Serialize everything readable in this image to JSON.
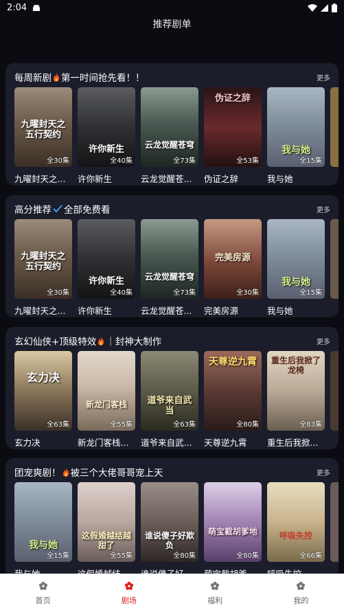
{
  "status": {
    "time": "2:04"
  },
  "header": {
    "title": "推荐剧单"
  },
  "sections": [
    {
      "title_a": "每周新剧",
      "title_b": "第一时间抢先看！！",
      "more": "更多",
      "items": [
        {
          "name": "九曜封天之...",
          "ep": "全30集",
          "poster_text": "九曜封天之五行契约",
          "color": "#6b5b4a"
        },
        {
          "name": "许你新生",
          "ep": "全40集",
          "poster_text": "许你新生",
          "color": "#2f3033"
        },
        {
          "name": "云龙觉醒苍...",
          "ep": "全73集",
          "poster_text": "云龙觉醒苍穹",
          "color": "#4a5a52"
        },
        {
          "name": "伪证之辞",
          "ep": "全53集",
          "poster_text": "伪证之辞",
          "color": "#4a1f22"
        },
        {
          "name": "我与她",
          "ep": "全15集",
          "poster_text": "我与她",
          "color": "#7d8a98"
        }
      ]
    },
    {
      "title_a": "高分推荐",
      "title_b": "全部免费看",
      "more": "更多",
      "items": [
        {
          "name": "九曜封天之...",
          "ep": "全30集",
          "poster_text": "九曜封天之五行契约",
          "color": "#6b5b4a"
        },
        {
          "name": "许你新生",
          "ep": "全40集",
          "poster_text": "许你新生",
          "color": "#2f3033"
        },
        {
          "name": "云龙觉醒苍...",
          "ep": "全73集",
          "poster_text": "云龙觉醒苍穹",
          "color": "#4a5a52"
        },
        {
          "name": "完美房源",
          "ep": "全30集",
          "poster_text": "完美房源",
          "color": "#7a4638"
        },
        {
          "name": "我与她",
          "ep": "全15集",
          "poster_text": "我与她",
          "color": "#7d8a98"
        }
      ]
    },
    {
      "title_a": "玄幻仙侠+顶级特效",
      "title_b": "｜封神大制作",
      "more": "更多",
      "items": [
        {
          "name": "玄力决",
          "ep": "全63集",
          "poster_text": "玄力决",
          "color": "#8a7658"
        },
        {
          "name": "新龙门客栈...",
          "ep": "全55集",
          "poster_text": "新龙门客栈",
          "color": "#c9b8a6"
        },
        {
          "name": "道爷来自武...",
          "ep": "全63集",
          "poster_text": "道爷来自武当",
          "color": "#5c5a48"
        },
        {
          "name": "天尊逆九霄",
          "ep": "全80集",
          "poster_text": "天尊逆九霄",
          "color": "#5a3a34"
        },
        {
          "name": "重生后我掀...",
          "ep": "全83集",
          "poster_text": "重生后我掀了龙椅",
          "color": "#b9aa96"
        }
      ]
    },
    {
      "title_a": "团宠爽剧！",
      "title_b": "被三个大佬哥哥宠上天",
      "more": "更多",
      "items": [
        {
          "name": "我与她",
          "ep": "全15集",
          "poster_text": "我与她",
          "color": "#7d8a98"
        },
        {
          "name": "这假婚越结...",
          "ep": "全55集",
          "poster_text": "这假婚越结越甜了",
          "color": "#b9a7a0"
        },
        {
          "name": "谁说傻子好...",
          "ep": "全80集",
          "poster_text": "谁说傻子好欺负",
          "color": "#6b5e59"
        },
        {
          "name": "萌宝截胡爹...",
          "ep": "全80集",
          "poster_text": "萌宝截胡爹地",
          "color": "#7a5f8a"
        },
        {
          "name": "呼吸失控",
          "ep": "全66集",
          "poster_text": "呼吸失控",
          "color": "#c8b48c"
        }
      ]
    }
  ],
  "bottom_nav": [
    {
      "label": "首页",
      "active": false
    },
    {
      "label": "剧场",
      "active": true
    },
    {
      "label": "福利",
      "active": false
    },
    {
      "label": "我的",
      "active": false
    }
  ],
  "colors": {
    "background": "#0b0c12",
    "section": "#1b1d2b",
    "accent": "#e02020"
  }
}
